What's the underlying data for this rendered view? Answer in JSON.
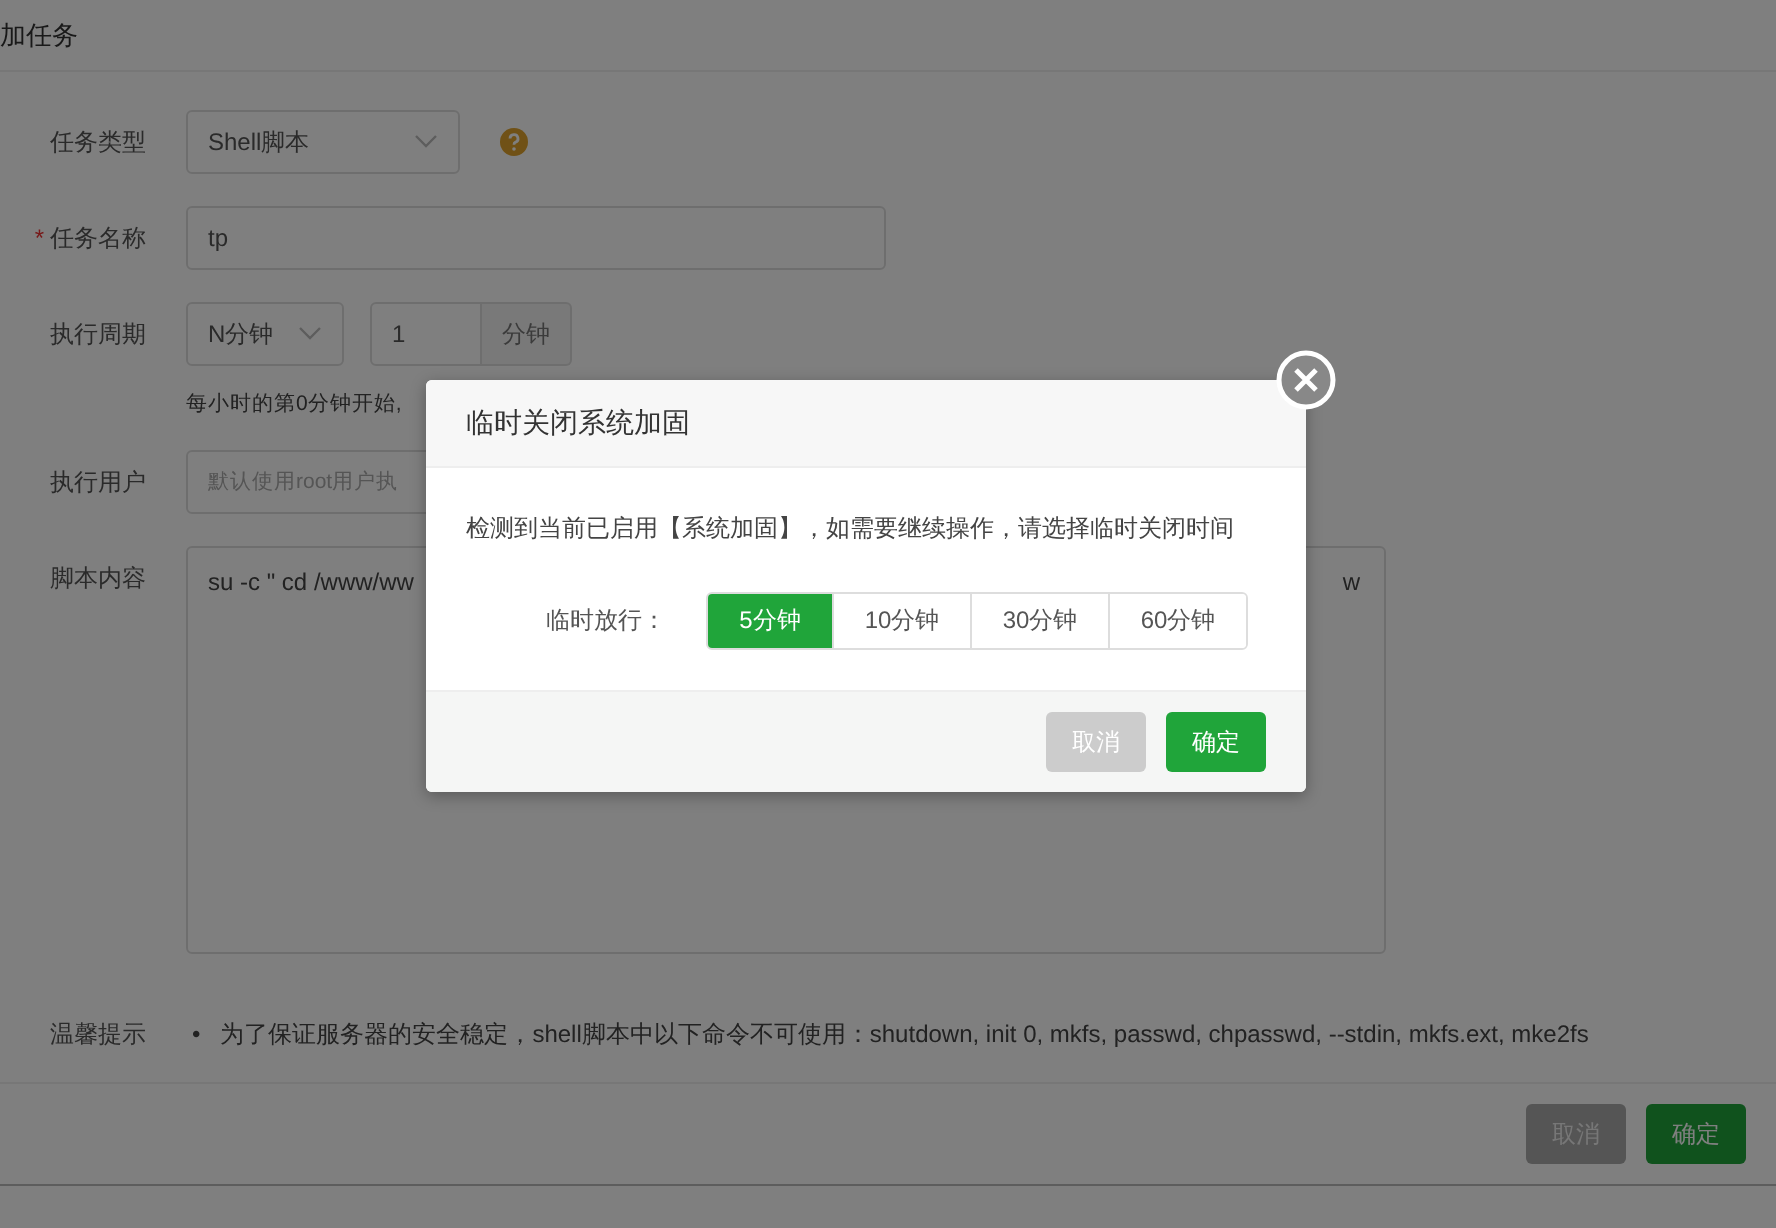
{
  "page": {
    "title": "加任务",
    "fields": [
      {
        "kind": "select",
        "label": "任务类型",
        "value": "Shell脚本",
        "help": true
      },
      {
        "kind": "input",
        "label": "任务名称",
        "required_mark": "*",
        "value": "tp"
      },
      {
        "kind": "period",
        "label": "执行周期",
        "value": "N分钟",
        "number": "1",
        "unit": "分钟",
        "hint": "每小时的第0分钟开始,"
      },
      {
        "kind": "input",
        "label": "执行用户",
        "placeholder": "默认使用root用户执"
      },
      {
        "kind": "textarea",
        "label": "脚本内容",
        "value": "su -c \" cd /www/ww",
        "value_tail": "w"
      }
    ],
    "tip": {
      "label": "温馨提示",
      "bullet": "•",
      "text": "为了保证服务器的安全稳定，shell脚本中以下命令不可使用：shutdown, init 0, mkfs, passwd, chpasswd, --stdin, mkfs.ext, mke2fs"
    },
    "buttons": [
      {
        "label": "取消",
        "kind": "cancel"
      },
      {
        "label": "确定",
        "kind": "confirm"
      }
    ]
  },
  "dialog": {
    "title": "临时关闭系统加固",
    "message": "检测到当前已启用【系统加固】，如需要继续操作，请选择临时关闭时间",
    "option_label": "临时放行：",
    "options": [
      {
        "label": "5分钟",
        "selected": true
      },
      {
        "label": "10分钟",
        "selected": false
      },
      {
        "label": "30分钟",
        "selected": false
      },
      {
        "label": "60分钟",
        "selected": false
      }
    ],
    "buttons": [
      {
        "label": "取消",
        "kind": "cancel"
      },
      {
        "label": "确定",
        "kind": "confirm"
      }
    ]
  }
}
